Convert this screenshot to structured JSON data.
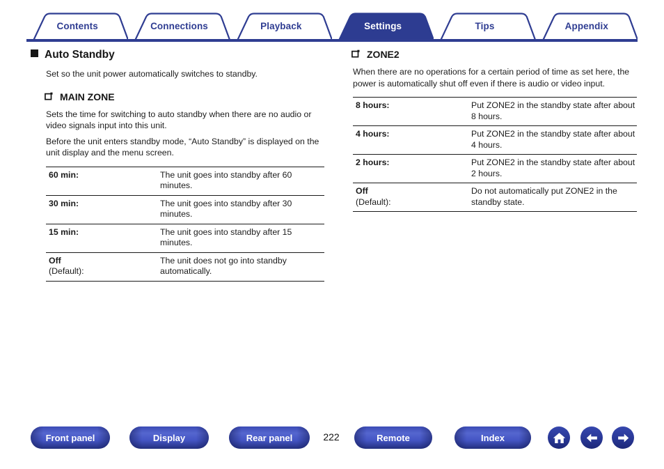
{
  "nav_tabs": [
    {
      "label": "Contents",
      "active": false
    },
    {
      "label": "Connections",
      "active": false
    },
    {
      "label": "Playback",
      "active": false
    },
    {
      "label": "Settings",
      "active": true
    },
    {
      "label": "Tips",
      "active": false
    },
    {
      "label": "Appendix",
      "active": false
    }
  ],
  "left_column": {
    "section_heading": "Auto Standby",
    "section_intro": "Set so the unit power automatically switches to standby.",
    "sub_heading": "MAIN ZONE",
    "sub_paragraph_1": "Sets the time for switching to auto standby when there are no audio or video signals input into this unit.",
    "sub_paragraph_2": "Before the unit enters standby mode, “Auto Standby” is displayed on the unit display and the menu screen.",
    "table": [
      {
        "term": "60 min:",
        "default_note": "",
        "desc": "The unit goes into standby after 60 minutes."
      },
      {
        "term": "30 min:",
        "default_note": "",
        "desc": "The unit goes into standby after 30 minutes."
      },
      {
        "term": "15 min:",
        "default_note": "",
        "desc": "The unit goes into standby after 15 minutes."
      },
      {
        "term": "Off",
        "default_note": "(Default):",
        "desc": "The unit does not go into standby automatically."
      }
    ]
  },
  "right_column": {
    "sub_heading": "ZONE2",
    "sub_paragraph_1": "When there are no operations for a certain period of time as set here, the power is automatically shut off even if there is audio or video input.",
    "table": [
      {
        "term": "8 hours:",
        "default_note": "",
        "desc": "Put ZONE2 in the standby state after about 8 hours."
      },
      {
        "term": "4 hours:",
        "default_note": "",
        "desc": "Put ZONE2 in the standby state after about 4 hours."
      },
      {
        "term": "2 hours:",
        "default_note": "",
        "desc": "Put ZONE2 in the standby state after about 2 hours."
      },
      {
        "term": "Off",
        "default_note": "(Default):",
        "desc": "Do not automatically put ZONE2 in the standby state."
      }
    ]
  },
  "footer": {
    "front_panel_label": "Front panel",
    "display_label": "Display",
    "rear_panel_label": "Rear panel",
    "page_number": "222",
    "remote_label": "Remote",
    "index_label": "Index",
    "home_icon": "home-icon",
    "back_icon": "arrow-left-icon",
    "forward_icon": "arrow-right-icon"
  },
  "colors": {
    "brand_blue": "#2f3d92",
    "tab_active_fill": "#2d3c91",
    "tab_text": "#2f3d92",
    "body_text": "#1c1c1c"
  }
}
